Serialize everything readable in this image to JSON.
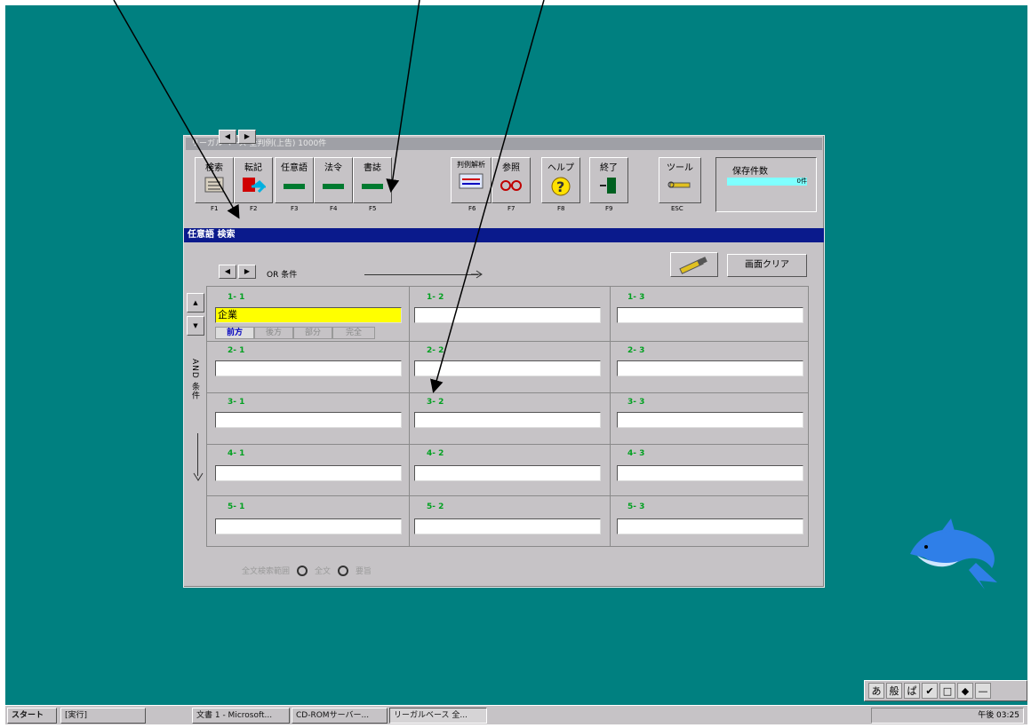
{
  "window": {
    "title": "リーガルベース 全判例(上告)  1000件"
  },
  "toolbar": [
    {
      "label": "検索",
      "key": "F1"
    },
    {
      "label": "転記",
      "key": "F2"
    },
    {
      "label": "任意語",
      "key": "F3"
    },
    {
      "label": "法令",
      "key": "F4"
    },
    {
      "label": "書誌",
      "key": "F5"
    },
    {
      "label": "判例解析",
      "key": "F6"
    },
    {
      "label": "参照",
      "key": "F7"
    },
    {
      "label": "ヘルプ",
      "key": "F8"
    },
    {
      "label": "終了",
      "key": "F9"
    },
    {
      "label": "ツール",
      "key": "ESC"
    }
  ],
  "saved": {
    "label": "保存件数",
    "count": "0件"
  },
  "section": {
    "title": "任意語 検索"
  },
  "search": {
    "or_label": "OR 条件",
    "clear_label": "画面クリア",
    "and_label": "AND 条件",
    "option_tabs": [
      "前方",
      "後方",
      "部分",
      "完全"
    ],
    "rows": [
      [
        {
          "label": "1- 1",
          "value": "企業"
        },
        {
          "label": "1- 2",
          "value": ""
        },
        {
          "label": "1- 3",
          "value": ""
        }
      ],
      [
        {
          "label": "2- 1",
          "value": ""
        },
        {
          "label": "2- 2",
          "value": ""
        },
        {
          "label": "2- 3",
          "value": ""
        }
      ],
      [
        {
          "label": "3- 1",
          "value": ""
        },
        {
          "label": "3- 2",
          "value": ""
        },
        {
          "label": "3- 3",
          "value": ""
        }
      ],
      [
        {
          "label": "4- 1",
          "value": ""
        },
        {
          "label": "4- 2",
          "value": ""
        },
        {
          "label": "4- 3",
          "value": ""
        }
      ],
      [
        {
          "label": "5- 1",
          "value": ""
        },
        {
          "label": "5- 2",
          "value": ""
        },
        {
          "label": "5- 3",
          "value": ""
        }
      ]
    ],
    "bottom": {
      "label": "全文検索範囲",
      "opt1": "全文",
      "opt2": "要旨"
    }
  },
  "taskbar": {
    "start": "スタート",
    "items": [
      "[実行]",
      "文書 1 - Microsoft...",
      "CD-ROMサーバー...",
      "リーガルベース 全..."
    ],
    "clock": "午後 03:25"
  },
  "ime": [
    "あ",
    "般",
    "ぱ",
    "✔",
    "□",
    "◆",
    "—"
  ],
  "colors": {
    "desktop": "#008080",
    "title_bar": "#0a1a8c",
    "highlight": "#ffff00",
    "label_green": "#00a020"
  }
}
